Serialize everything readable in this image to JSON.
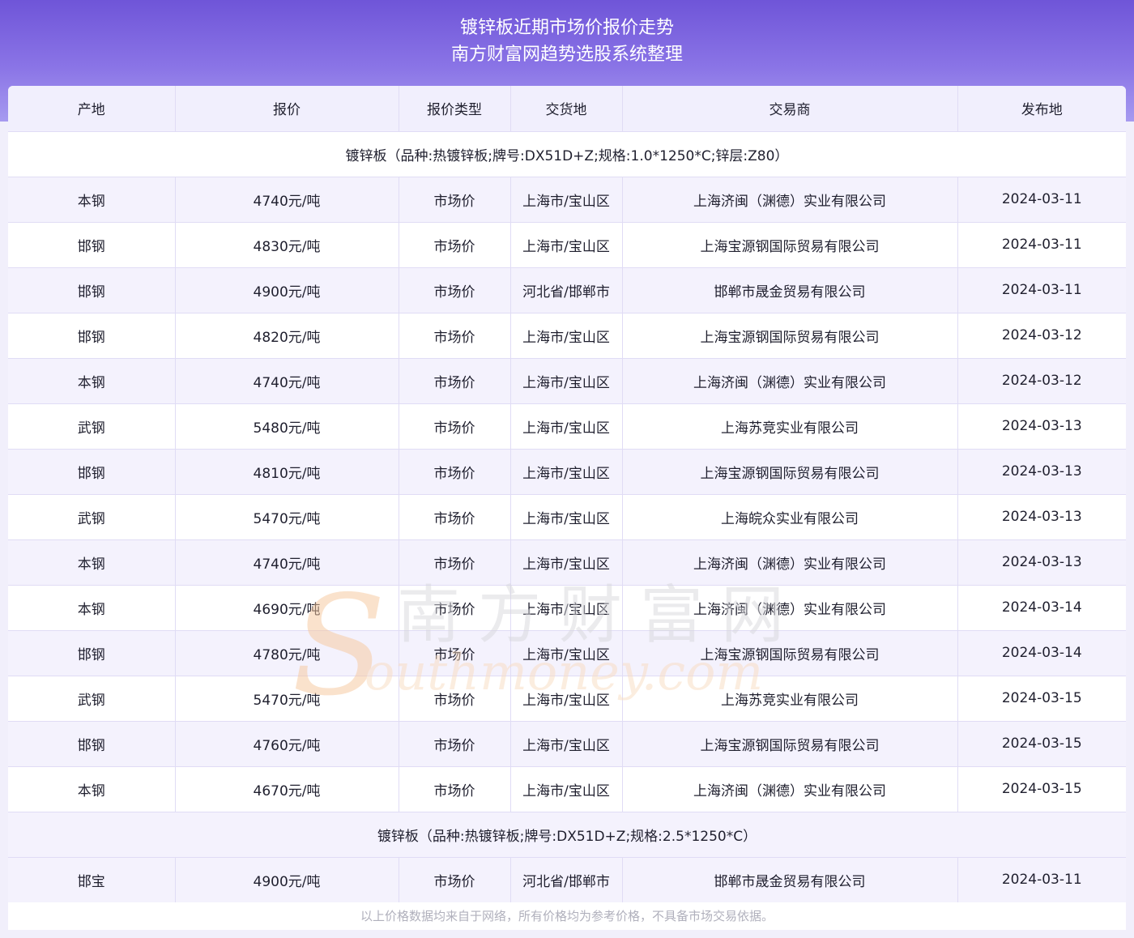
{
  "header": {
    "title_line1": "镀锌板近期市场价报价走势",
    "title_line2": "南方财富网趋势选股系统整理"
  },
  "table": {
    "columns": [
      "产地",
      "报价",
      "报价类型",
      "交货地",
      "交易商",
      "发布地"
    ],
    "groups": [
      {
        "label": "镀锌板（品种:热镀锌板;牌号:DX51D+Z;规格:1.0*1250*C;锌层:Z80）",
        "rows": [
          [
            "本钢",
            "4740元/吨",
            "市场价",
            "上海市/宝山区",
            "上海济闽（渊德）实业有限公司",
            "2024-03-11"
          ],
          [
            "邯钢",
            "4830元/吨",
            "市场价",
            "上海市/宝山区",
            "上海宝源钢国际贸易有限公司",
            "2024-03-11"
          ],
          [
            "邯钢",
            "4900元/吨",
            "市场价",
            "河北省/邯郸市",
            "邯郸市晟金贸易有限公司",
            "2024-03-11"
          ],
          [
            "邯钢",
            "4820元/吨",
            "市场价",
            "上海市/宝山区",
            "上海宝源钢国际贸易有限公司",
            "2024-03-12"
          ],
          [
            "本钢",
            "4740元/吨",
            "市场价",
            "上海市/宝山区",
            "上海济闽（渊德）实业有限公司",
            "2024-03-12"
          ],
          [
            "武钢",
            "5480元/吨",
            "市场价",
            "上海市/宝山区",
            "上海苏竞实业有限公司",
            "2024-03-13"
          ],
          [
            "邯钢",
            "4810元/吨",
            "市场价",
            "上海市/宝山区",
            "上海宝源钢国际贸易有限公司",
            "2024-03-13"
          ],
          [
            "武钢",
            "5470元/吨",
            "市场价",
            "上海市/宝山区",
            "上海皖众实业有限公司",
            "2024-03-13"
          ],
          [
            "本钢",
            "4740元/吨",
            "市场价",
            "上海市/宝山区",
            "上海济闽（渊德）实业有限公司",
            "2024-03-13"
          ],
          [
            "本钢",
            "4690元/吨",
            "市场价",
            "上海市/宝山区",
            "上海济闽（渊德）实业有限公司",
            "2024-03-14"
          ],
          [
            "邯钢",
            "4780元/吨",
            "市场价",
            "上海市/宝山区",
            "上海宝源钢国际贸易有限公司",
            "2024-03-14"
          ],
          [
            "武钢",
            "5470元/吨",
            "市场价",
            "上海市/宝山区",
            "上海苏竞实业有限公司",
            "2024-03-15"
          ],
          [
            "邯钢",
            "4760元/吨",
            "市场价",
            "上海市/宝山区",
            "上海宝源钢国际贸易有限公司",
            "2024-03-15"
          ],
          [
            "本钢",
            "4670元/吨",
            "市场价",
            "上海市/宝山区",
            "上海济闽（渊德）实业有限公司",
            "2024-03-15"
          ]
        ]
      },
      {
        "label": "镀锌板（品种:热镀锌板;牌号:DX51D+Z;规格:2.5*1250*C）",
        "rows": [
          [
            "邯宝",
            "4900元/吨",
            "市场价",
            "河北省/邯郸市",
            "邯郸市晟金贸易有限公司",
            "2024-03-11"
          ]
        ]
      }
    ]
  },
  "watermark": {
    "text_cn": "南方财富网",
    "text_en": "outhmoney.com"
  },
  "footer": {
    "note": "以上价格数据均来自于网络，所有价格均为参考价格，不具备市场交易依据。"
  },
  "colors": {
    "banner_top": "#6f55d8",
    "banner_bottom": "#a69af0",
    "row_alt": "#f4f2fd",
    "border": "#e0dcf5",
    "footer_text": "#b0b0bc"
  }
}
